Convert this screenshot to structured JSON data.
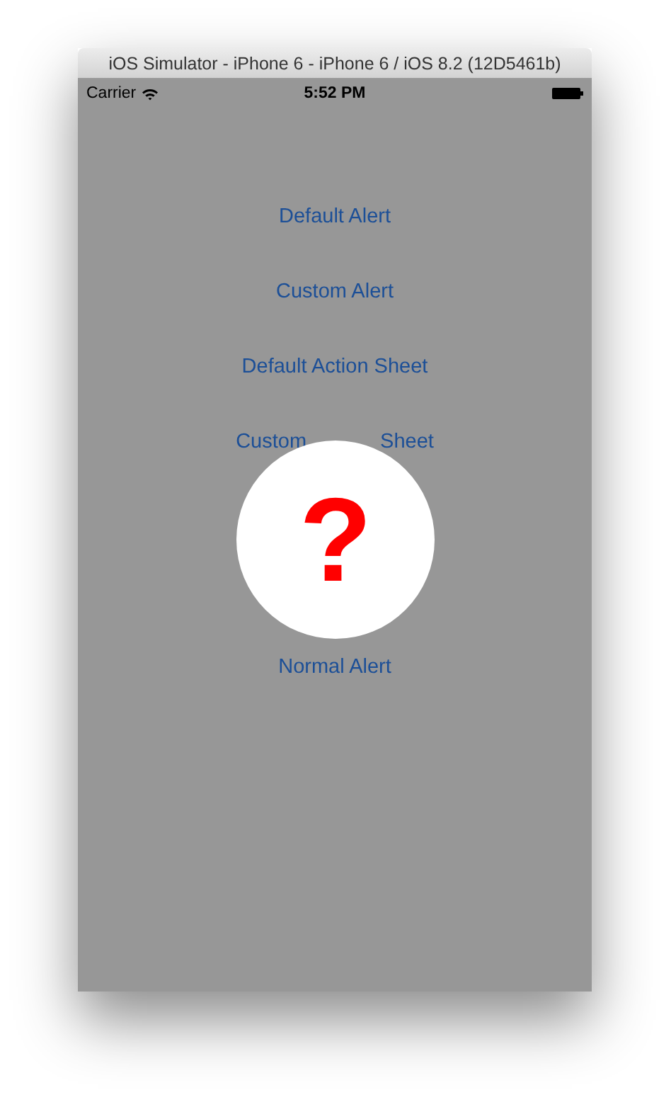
{
  "window": {
    "title": "iOS Simulator - iPhone 6 - iPhone 6 / iOS 8.2 (12D5461b)"
  },
  "status_bar": {
    "carrier": "Carrier",
    "time": "5:52 PM"
  },
  "buttons": [
    {
      "label": "Default Alert"
    },
    {
      "label": "Custom Alert"
    },
    {
      "label": "Default Action Sheet"
    },
    {
      "label_parts": [
        "Custom",
        "Sheet"
      ]
    },
    {
      "label": "Normal Alert"
    }
  ],
  "overlay": {
    "symbol": "?"
  }
}
